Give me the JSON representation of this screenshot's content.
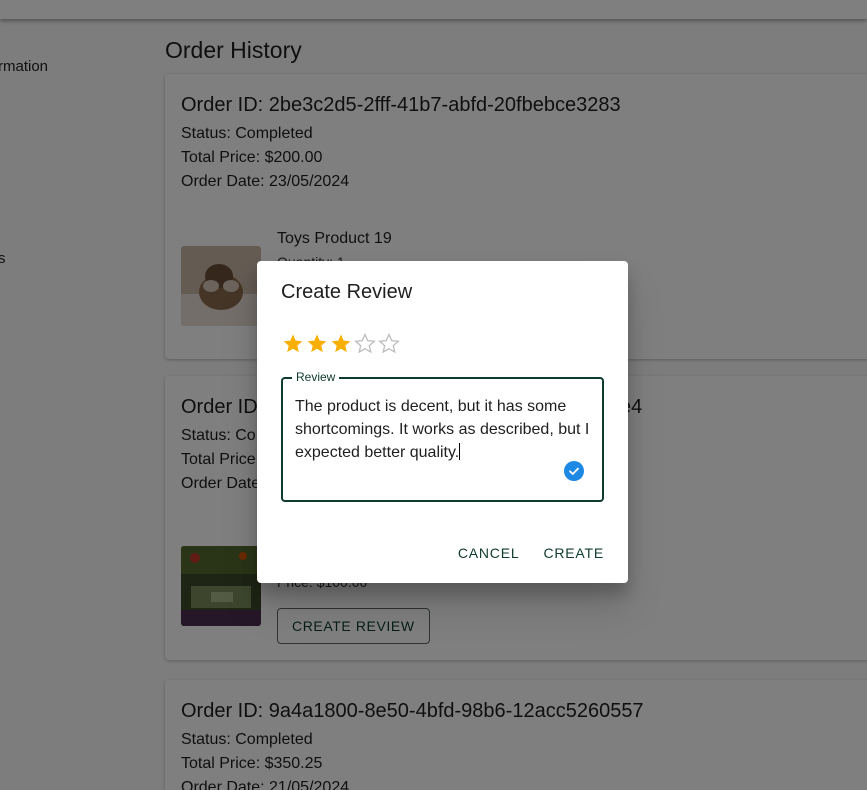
{
  "sidebar": {
    "items": [
      {
        "label": "rmation"
      },
      {
        "label": "s"
      }
    ]
  },
  "main": {
    "title": "Order History",
    "orders": [
      {
        "id_line": "Order ID: 2be3c2d5-2fff-41b7-abfd-20fbebce3283",
        "status": "Status: Completed",
        "total": "Total Price: $200.00",
        "date": "Order Date: 23/05/2024",
        "product": {
          "name": "Toys Product 19",
          "quantity": "Quantity: 1"
        }
      },
      {
        "id_line": "Order ID: ···4",
        "id_prefix": "Order ID",
        "id_suffix": "e4",
        "status_prefix": "Status: Co",
        "total_prefix": "Total Price",
        "date_prefix": "Order Date",
        "product": {
          "price": "Price: $100.00"
        },
        "create_review_label": "CREATE REVIEW"
      },
      {
        "id_line": "Order ID: 9a4a1800-8e50-4bfd-98b6-12acc5260557",
        "status": "Status: Completed",
        "total": "Total Price: $350.25",
        "date": "Order Date: 21/05/2024"
      }
    ]
  },
  "dialog": {
    "title": "Create Review",
    "rating": 3,
    "rating_max": 5,
    "review": {
      "label": "Review",
      "value": "The product is decent, but it has some shortcomings. It works as described, but I expected better quality."
    },
    "cancel_label": "CANCEL",
    "create_label": "CREATE"
  },
  "colors": {
    "accent": "#0e3b2c",
    "star_filled": "#faaf00",
    "star_empty": "#bdbdbd",
    "check": "#1e88e5"
  }
}
